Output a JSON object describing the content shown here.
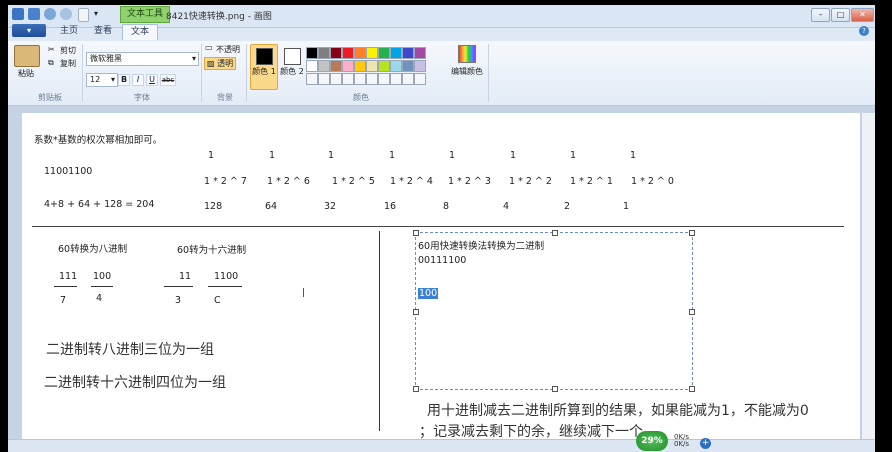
{
  "window": {
    "context_tab": "文本工具",
    "title": "8421快速转换.png - 画图",
    "minimize": "–",
    "maximize": "□",
    "close": "✕"
  },
  "tabs": {
    "app_menu": "▾",
    "home": "主页",
    "view": "查看",
    "text": "文本",
    "help": "?"
  },
  "ribbon": {
    "clipboard": {
      "paste": "粘贴",
      "cut": "剪切",
      "copy": "复制",
      "group": "剪贴板"
    },
    "font": {
      "family": "微软雅黑",
      "size": "12",
      "bold": "B",
      "italic": "I",
      "underline": "U",
      "strike": "abc",
      "group": "字体"
    },
    "background": {
      "opaque": "不透明",
      "transparent": "透明",
      "group": "背景"
    },
    "colors": {
      "color1": "颜色 1",
      "color2": "颜色 2",
      "edit": "编辑颜色",
      "group": "颜色",
      "color1_value": "#000000",
      "color2_value": "#ffffff",
      "palette_row1": [
        "#000000",
        "#7f7f7f",
        "#880015",
        "#ed1c24",
        "#ff7f27",
        "#fff200",
        "#22b14c",
        "#00a2e8",
        "#3f48cc",
        "#a349a4"
      ],
      "palette_row2": [
        "#ffffff",
        "#c3c3c3",
        "#b97a57",
        "#ffaec9",
        "#ffc90e",
        "#efe4b0",
        "#b5e61d",
        "#99d9ea",
        "#7092be",
        "#c8bfe7"
      ]
    }
  },
  "canvas": {
    "note_top": "系数*基数的权次幂相加即可。",
    "binary_number": "11001100",
    "sum_expression": "4+8 + 64 + 128 = 204",
    "coefficients": [
      "1",
      "1",
      "1",
      "1",
      "1",
      "1",
      "1",
      "1"
    ],
    "powers": [
      "1 * 2 ^ 7",
      "1 * 2 ^ 6",
      "1 * 2 ^ 5",
      "1 * 2 ^ 4",
      "1 * 2 ^ 3",
      "1 * 2 ^ 2",
      "1 * 2 ^ 1",
      "1 * 2 ^ 0"
    ],
    "weights": [
      "128",
      "64",
      "32",
      "16",
      "8",
      "4",
      "2",
      "1"
    ],
    "octal_title": "60转换为八进制",
    "octal_groups": [
      "111",
      "100"
    ],
    "octal_digits": [
      "7",
      "4"
    ],
    "hex_title": "60转为十六进制",
    "hex_groups": [
      "11",
      "1100"
    ],
    "hex_digits": [
      "3",
      "C"
    ],
    "rule_octal": "二进制转八进制三位为一组",
    "rule_hex": "二进制转十六进制四位为一组",
    "fast_title": "60用快速转换法转换为二进制",
    "fast_binary": "00111100",
    "selected_text": "100",
    "explanation_line1": "用十进制减去二进制所算到的结果，如果能减为1，不能减为0",
    "explanation_line2": "；记录减去剩下的余，继续减下一个"
  },
  "status": {
    "badge": "29%",
    "net_up": "0K/s",
    "net_down": "0K/s",
    "plus": "+"
  }
}
